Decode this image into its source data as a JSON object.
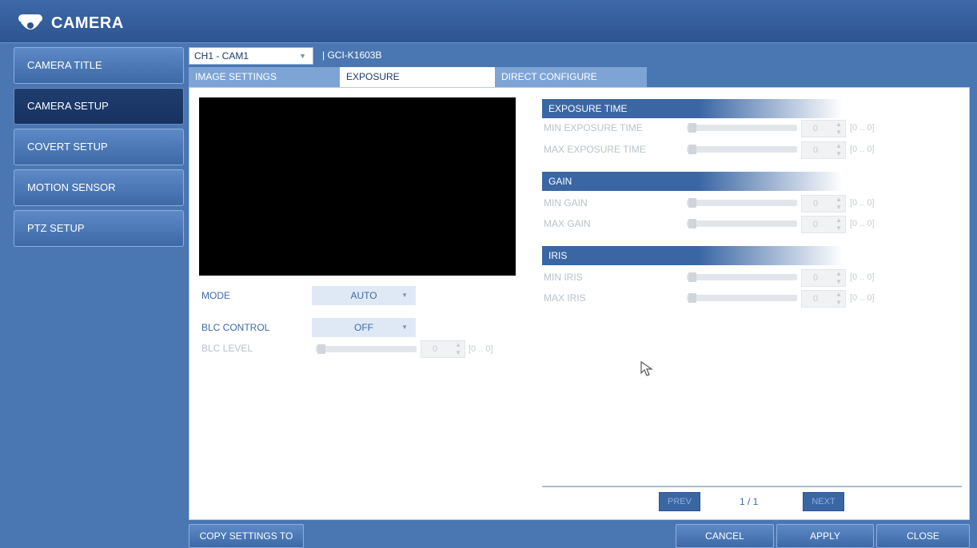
{
  "window": {
    "title": "CAMERA"
  },
  "sidebar": {
    "items": [
      {
        "label": "CAMERA TITLE"
      },
      {
        "label": "CAMERA SETUP"
      },
      {
        "label": "COVERT SETUP"
      },
      {
        "label": "MOTION SENSOR"
      },
      {
        "label": "PTZ SETUP"
      }
    ],
    "active": "CAMERA SETUP"
  },
  "channel": {
    "selected": "CH1 - CAM1",
    "model": "|  GCI-K1603B"
  },
  "tabs": [
    {
      "label": "IMAGE SETTINGS"
    },
    {
      "label": "EXPOSURE"
    },
    {
      "label": "DIRECT CONFIGURE"
    }
  ],
  "active_tab": "EXPOSURE",
  "left": {
    "mode": {
      "label": "MODE",
      "value": "AUTO"
    },
    "blc_control": {
      "label": "BLC CONTROL",
      "value": "OFF"
    },
    "blc_level": {
      "label": "BLC LEVEL",
      "value": "0",
      "range": "[0 .. 0]"
    }
  },
  "sections": {
    "exposure_time": {
      "title": "EXPOSURE TIME",
      "min": {
        "label": "MIN EXPOSURE TIME",
        "value": "0",
        "range": "[0 .. 0]"
      },
      "max": {
        "label": "MAX EXPOSURE TIME",
        "value": "0",
        "range": "[0 .. 0]"
      }
    },
    "gain": {
      "title": "GAIN",
      "min": {
        "label": "MIN GAIN",
        "value": "0",
        "range": "[0 .. 0]"
      },
      "max": {
        "label": "MAX GAIN",
        "value": "0",
        "range": "[0 .. 0]"
      }
    },
    "iris": {
      "title": "IRIS",
      "min": {
        "label": "MIN IRIS",
        "value": "0",
        "range": "[0 .. 0]"
      },
      "max": {
        "label": "MAX IRIS",
        "value": "0",
        "range": "[0 .. 0]"
      }
    }
  },
  "pagination": {
    "prev": "PREV",
    "page": "1 / 1",
    "next": "NEXT"
  },
  "buttons": {
    "copy": "COPY SETTINGS TO",
    "cancel": "CANCEL",
    "apply": "APPLY",
    "close": "CLOSE"
  },
  "colors": {
    "accent": "#3a66a4",
    "background": "#4a76b2",
    "panel": "#ffffff"
  }
}
